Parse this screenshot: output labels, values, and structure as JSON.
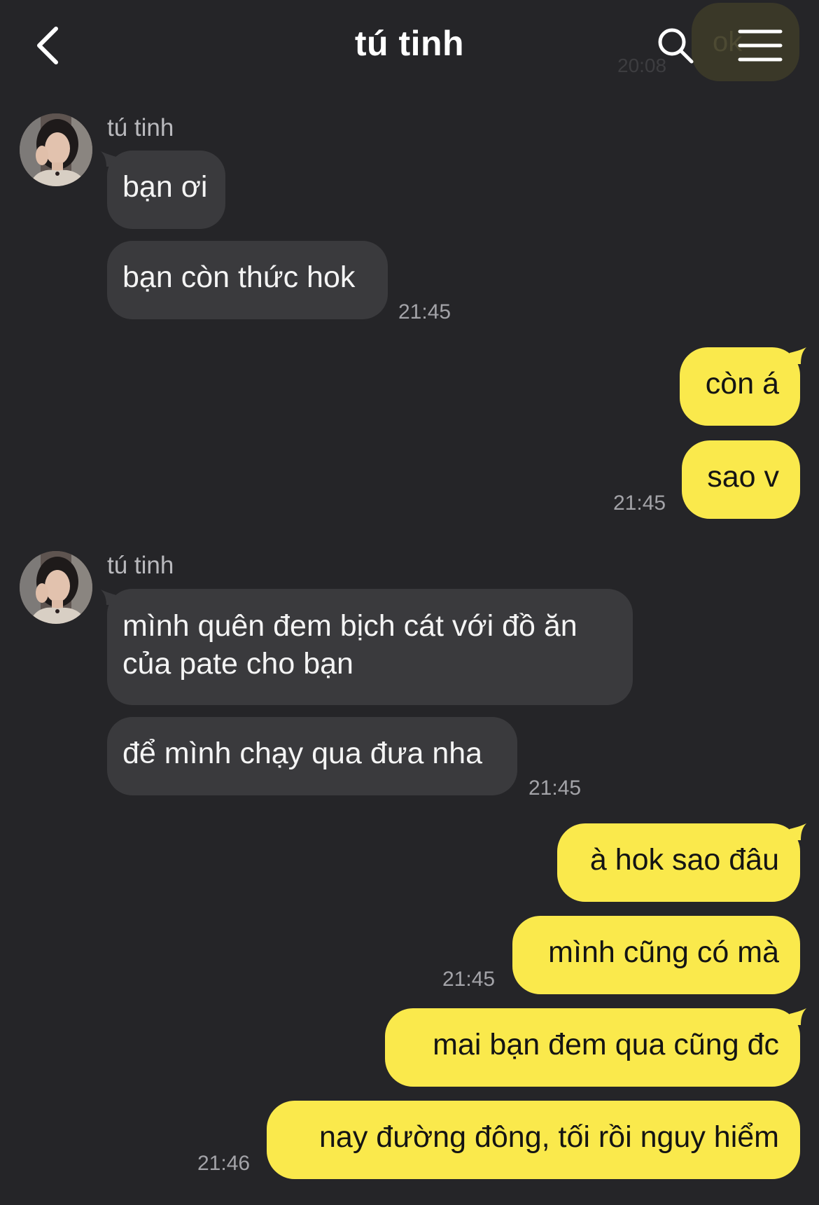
{
  "header": {
    "title": "tú tinh",
    "background_peek_text": "ok",
    "background_peek_time": "20:08"
  },
  "colors": {
    "background": "#252528",
    "incoming_bubble": "#3a3a3d",
    "outgoing_bubble": "#fae94c",
    "timestamp": "#a3a3a8"
  },
  "icons": {
    "back": "chevron-left-icon",
    "search": "search-icon",
    "menu": "hamburger-menu-icon"
  },
  "messages": [
    {
      "direction": "in",
      "sender": "tú tinh",
      "texts": [
        "bạn ơi",
        "bạn còn thức hok"
      ],
      "time": "21:45"
    },
    {
      "direction": "out",
      "texts": [
        "còn á",
        "sao v"
      ],
      "time": "21:45"
    },
    {
      "direction": "in",
      "sender": "tú tinh",
      "texts": [
        "mình quên đem bịch cát với đồ ăn của pate cho bạn",
        "để mình chạy qua đưa nha"
      ],
      "time": "21:45"
    },
    {
      "direction": "out",
      "texts": [
        "à hok sao đâu",
        "mình cũng có mà"
      ],
      "time": "21:45"
    },
    {
      "direction": "out",
      "texts": [
        "mai bạn đem qua cũng đc",
        "nay đường đông, tối rồi nguy hiểm"
      ],
      "time": "21:46"
    }
  ]
}
